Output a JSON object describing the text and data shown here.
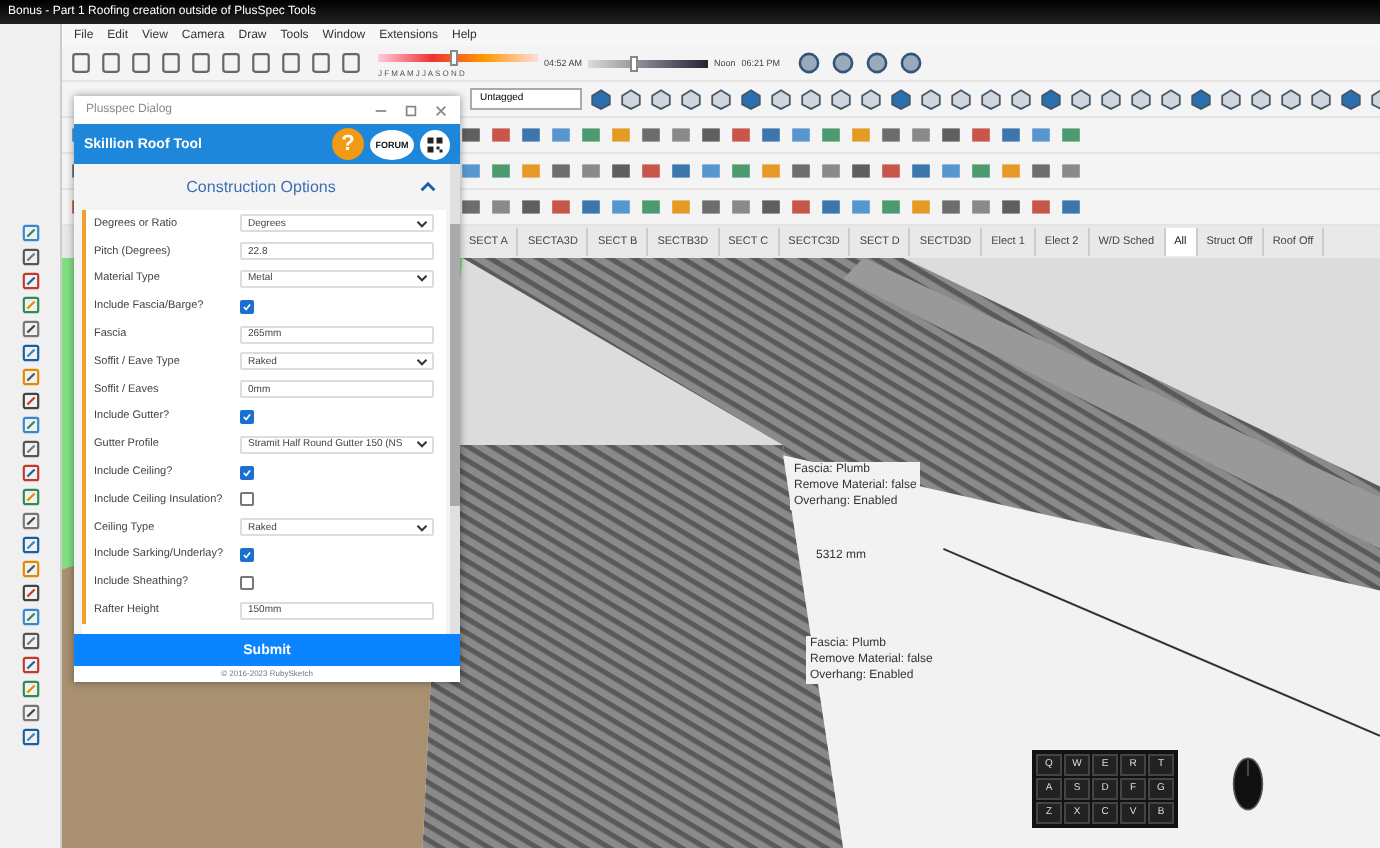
{
  "window": {
    "title": "Bonus - Part 1 Roofing creation outside of PlusSpec Tools"
  },
  "menu": [
    "File",
    "Edit",
    "View",
    "Camera",
    "Draw",
    "Tools",
    "Window",
    "Extensions",
    "Help"
  ],
  "shadows": {
    "months": "J F M A M J J A S O N D",
    "start_time": "04:52 AM",
    "mid_label": "Noon",
    "end_time": "06:21 PM",
    "level": 0.45,
    "time_slider": {
      "level": 0.35
    }
  },
  "tag_dropdown": {
    "value": "Untagged"
  },
  "scene_tabs": [
    {
      "label": "SECT A",
      "selected": false
    },
    {
      "label": "SECTA3D",
      "selected": false
    },
    {
      "label": "SECT B",
      "selected": false
    },
    {
      "label": "SECTB3D",
      "selected": false
    },
    {
      "label": "SECT C",
      "selected": false
    },
    {
      "label": "SECTC3D",
      "selected": false
    },
    {
      "label": "SECT D",
      "selected": false
    },
    {
      "label": "SECTD3D",
      "selected": false
    },
    {
      "label": "Elect 1",
      "selected": false
    },
    {
      "label": "Elect 2",
      "selected": false
    },
    {
      "label": "W/D Sched",
      "selected": false
    },
    {
      "label": "All",
      "selected": true
    },
    {
      "label": "Struct Off",
      "selected": false
    },
    {
      "label": "Roof Off",
      "selected": false
    }
  ],
  "annotations": [
    {
      "lines": [
        "Fascia: Plumb",
        "Remove Material: false",
        "Overhang: Enabled"
      ]
    },
    {
      "lines": [
        "Fascia: Plumb",
        "Remove Material: false",
        "Overhang: Enabled"
      ]
    }
  ],
  "dimension": "5312 mm",
  "dialog": {
    "title": "Plusspec Dialog",
    "tool_title": "Skillion Roof Tool",
    "help": "?",
    "forum": "FORUM",
    "section": "Construction Options",
    "submit": "Submit",
    "footer": "© 2016-2023 RubySketch",
    "fields": [
      {
        "kind": "select",
        "label": "Degrees or Ratio",
        "value": "Degrees"
      },
      {
        "kind": "input",
        "label": "Pitch (Degrees)",
        "value": "22.8"
      },
      {
        "kind": "select",
        "label": "Material Type",
        "value": "Metal"
      },
      {
        "kind": "checkbox",
        "label": "Include Fascia/Barge?",
        "checked": true
      },
      {
        "kind": "input",
        "label": "Fascia",
        "value": "265mm"
      },
      {
        "kind": "select",
        "label": "Soffit / Eave Type",
        "value": "Raked"
      },
      {
        "kind": "input",
        "label": "Soffit / Eaves",
        "value": "0mm"
      },
      {
        "kind": "checkbox",
        "label": "Include Gutter?",
        "checked": true
      },
      {
        "kind": "select",
        "label": "Gutter Profile",
        "value": "Stramit Half Round Gutter 150 (NS"
      },
      {
        "kind": "checkbox",
        "label": "Include Ceiling?",
        "checked": true
      },
      {
        "kind": "checkbox",
        "label": "Include Ceiling Insulation?",
        "checked": false
      },
      {
        "kind": "select",
        "label": "Ceiling Type",
        "value": "Raked"
      },
      {
        "kind": "checkbox",
        "label": "Include Sarking/Underlay?",
        "checked": true
      },
      {
        "kind": "checkbox",
        "label": "Include Sheathing?",
        "checked": false
      },
      {
        "kind": "input",
        "label": "Rafter Height",
        "value": "150mm"
      }
    ]
  },
  "keyboard": {
    "rows": [
      [
        "Q",
        "W",
        "E",
        "R",
        "T"
      ],
      [
        "A",
        "S",
        "D",
        "F",
        "G"
      ],
      [
        "Z",
        "X",
        "C",
        "V",
        "B"
      ]
    ]
  }
}
